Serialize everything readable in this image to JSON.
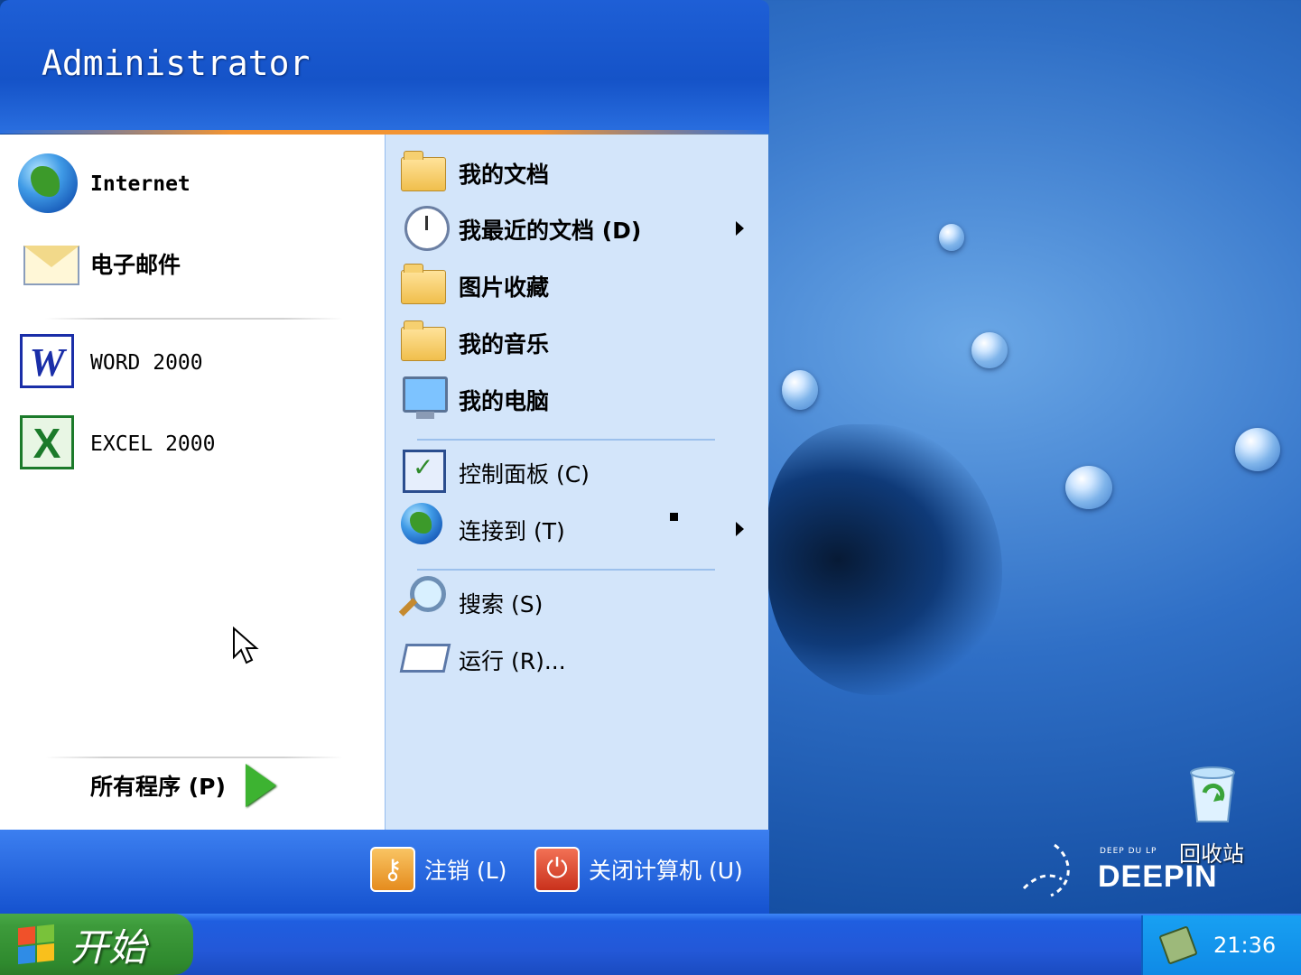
{
  "start_menu": {
    "user_name": "Administrator",
    "pinned": [
      {
        "label": "Internet",
        "icon": "globe-icon"
      },
      {
        "label": "电子邮件",
        "icon": "envelope-icon"
      }
    ],
    "recent_programs": [
      {
        "label": "WORD 2000",
        "icon": "word-icon"
      },
      {
        "label": "EXCEL 2000",
        "icon": "excel-icon"
      }
    ],
    "all_programs_label": "所有程序 (P)",
    "places": [
      {
        "label": "我的文档",
        "icon": "folder-icon"
      },
      {
        "label": "我最近的文档 (D)",
        "icon": "recent-docs-icon",
        "has_submenu": true
      },
      {
        "label": "图片收藏",
        "icon": "folder-icon"
      },
      {
        "label": "我的音乐",
        "icon": "folder-icon"
      },
      {
        "label": "我的电脑",
        "icon": "computer-icon"
      }
    ],
    "system": [
      {
        "label": "控制面板 (C)",
        "icon": "control-panel-icon"
      },
      {
        "label": "连接到 (T)",
        "icon": "network-icon",
        "has_submenu": true
      }
    ],
    "tools": [
      {
        "label": "搜索 (S)",
        "icon": "search-icon"
      },
      {
        "label": "运行 (R)...",
        "icon": "run-icon"
      }
    ],
    "footer": {
      "logoff_label": "注销 (L)",
      "shutdown_label": "关闭计算机 (U)"
    }
  },
  "desktop": {
    "recycle_bin_label": "回收站",
    "logo_small": "DEEP DU LP",
    "logo_big": "DEEPIN"
  },
  "taskbar": {
    "start_label": "开始",
    "clock": "21:36"
  },
  "colors": {
    "menu_header": "#1553c8",
    "taskbar": "#2358d8",
    "start_button": "#3d9b3b",
    "places_pane": "#d3e5fa"
  }
}
